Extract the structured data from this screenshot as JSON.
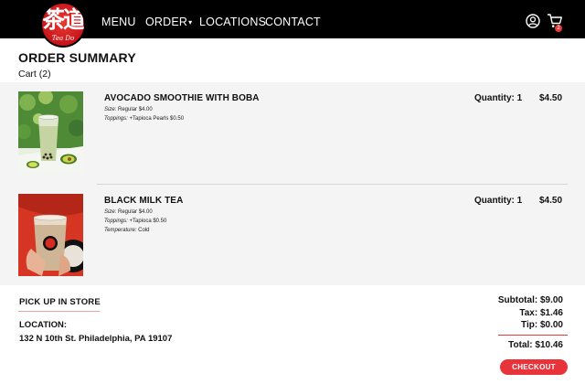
{
  "nav": {
    "logo_glyph": "茶道",
    "logo_script": "Tea Do",
    "items": [
      {
        "label": "MENU"
      },
      {
        "label": "ORDER"
      },
      {
        "label": "LOCATIONS"
      },
      {
        "label": "CONTACT"
      }
    ],
    "order_caret": "▾",
    "account_icon": "user-circle-icon",
    "cart_icon": "shopping-cart-icon",
    "cart_badge": "2"
  },
  "header": {
    "title": "ORDER SUMMARY",
    "cart_count": "Cart (2)"
  },
  "items": [
    {
      "name": "AVOCADO SMOOTHIE WITH BOBA",
      "options": [
        {
          "key": "Size:",
          "value": "Regular $4.00"
        },
        {
          "key": "Toppings:",
          "value": "+Tapioca Pearls $0.50"
        }
      ],
      "quantity": "Quantity: 1",
      "price": "$4.50"
    },
    {
      "name": "BLACK MILK TEA",
      "options": [
        {
          "key": "Size:",
          "value": "Regular $4.00"
        },
        {
          "key": "Toppings:",
          "value": "+Tapioca $0.50"
        },
        {
          "key": "Temperature:",
          "value": "Cold"
        }
      ],
      "quantity": "Quantity: 1",
      "price": "$4.50"
    }
  ],
  "pickup": {
    "title": "PICK UP IN STORE",
    "location_label": "LOCATION:",
    "address": "132 N 10th St. Philadelphia, PA 19107"
  },
  "summary": {
    "subtotal": "Subtotal: $9.00",
    "tax": "Tax: $1.46",
    "tip": "Tip: $0.00",
    "total": "Total: $10.46",
    "checkout_label": "CHECKOUT"
  },
  "colors": {
    "nav_bg": "#000000",
    "accent": "#e8333a",
    "items_bg": "#f4f4f4"
  }
}
